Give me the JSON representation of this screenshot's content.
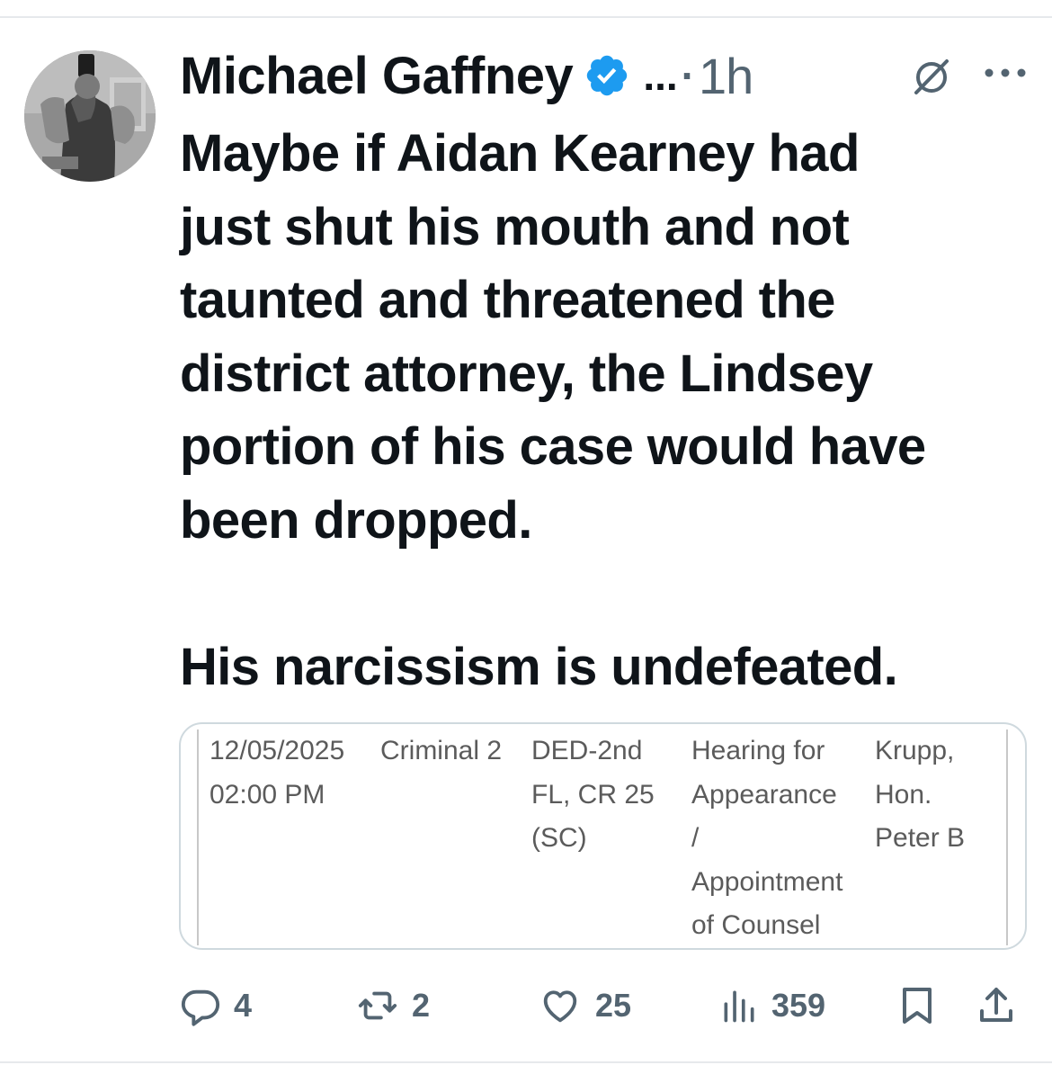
{
  "tweet": {
    "author_name": "Michael Gaffney",
    "verified": true,
    "overflow_text": "...",
    "separator": "·",
    "time": "1h",
    "text": "Maybe if Aidan Kearney had\njust shut his mouth and not\ntaunted and threatened the\ndistrict attorney, the Lindsey\nportion of his case would have\nbeen dropped.\n\nHis narcissism is undefeated."
  },
  "attached_image": {
    "row": {
      "date_time": "12/05/2025\n02:00 PM",
      "session": "Criminal 2",
      "location": "DED-2nd\nFL, CR 25\n(SC)",
      "event": "Hearing for\nAppearance\n/\nAppointment\nof Counsel",
      "judge": "Krupp,\nHon.\nPeter B"
    }
  },
  "actions": {
    "replies": "4",
    "reposts": "2",
    "likes": "25",
    "views": "359"
  },
  "icons": {
    "verified": "verified-badge-icon",
    "grok": "grok-icon",
    "more": "more-icon",
    "reply": "reply-icon",
    "repost": "repost-icon",
    "like": "heart-icon",
    "views": "views-icon",
    "bookmark": "bookmark-icon",
    "share": "share-icon"
  },
  "colors": {
    "accent": "#1d9bf0",
    "text": "#0f1419",
    "muted": "#536471",
    "border": "#cfd9de"
  }
}
